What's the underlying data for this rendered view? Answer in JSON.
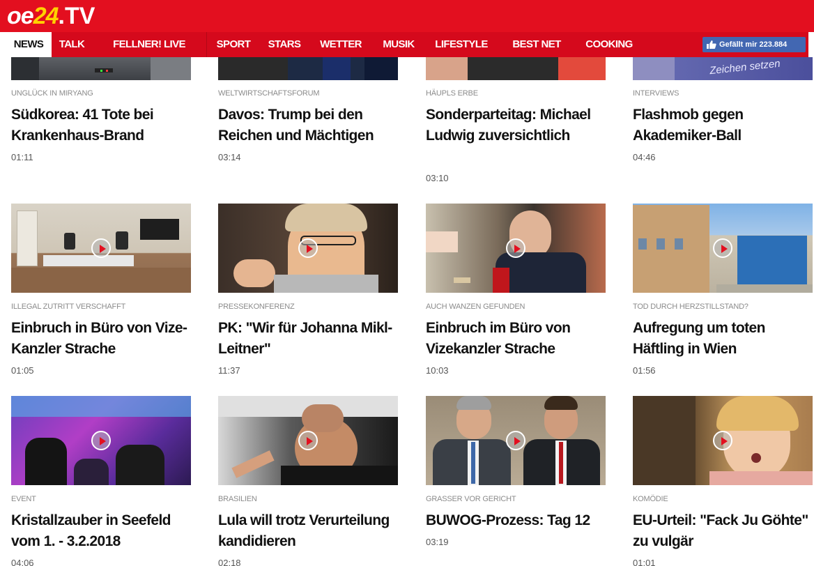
{
  "header": {
    "logo": {
      "part1": "oe",
      "part2": "24",
      "part3": ".TV"
    },
    "nav": [
      {
        "label": "NEWS",
        "active": true
      },
      {
        "label": "TALK"
      },
      {
        "label": "FELLNER! LIVE"
      },
      {
        "label": "SPORT"
      },
      {
        "label": "STARS"
      },
      {
        "label": "WETTER"
      },
      {
        "label": "MUSIK"
      },
      {
        "label": "LIFESTYLE"
      },
      {
        "label": "BEST NET"
      },
      {
        "label": "COOKING"
      }
    ],
    "like_button": {
      "icon": "thumbs-up-icon",
      "label": "Gefällt mir 223.884"
    }
  },
  "videos": [
    {
      "kicker": "UNGLÜCK IN MIRYANG",
      "title": "Südkorea: 41 Tote bei Krankenhaus-Brand",
      "duration": "01:11"
    },
    {
      "kicker": "WELTWIRTSCHAFTSFORUM",
      "title": "Davos: Trump bei den Reichen und Mächtigen",
      "duration": "03:14"
    },
    {
      "kicker": "HÄUPLS ERBE",
      "title": "Sonderparteitag: Michael Ludwig zuversichtlich",
      "duration": "03:10"
    },
    {
      "kicker": "INTERVIEWS",
      "title": "Flashmob gegen Akademiker-Ball",
      "duration": "04:46",
      "image_text": "Zeichen setzen"
    },
    {
      "kicker": "ILLEGAL ZUTRITT VERSCHAFFT",
      "title": "Einbruch in Büro von Vize-Kanzler Strache",
      "duration": "01:05"
    },
    {
      "kicker": "PRESSEKONFERENZ",
      "title": "PK: \"Wir für Johanna Mikl-Leitner\"",
      "duration": "11:37"
    },
    {
      "kicker": "AUCH WANZEN GEFUNDEN",
      "title": "Einbruch im Büro von Vizekanzler Strache",
      "duration": "10:03"
    },
    {
      "kicker": "TOD DURCH HERZSTILLSTAND?",
      "title": "Aufregung um toten Häftling in Wien",
      "duration": "01:56"
    },
    {
      "kicker": "EVENT",
      "title": "Kristallzauber in Seefeld vom 1. - 3.2.2018",
      "duration": "04:06"
    },
    {
      "kicker": "BRASILIEN",
      "title": "Lula will trotz Verurteilung kandidieren",
      "duration": "02:18"
    },
    {
      "kicker": "GRASSER VOR GERICHT",
      "title": "BUWOG-Prozess: Tag 12",
      "duration": "03:19"
    },
    {
      "kicker": "KOMÖDIE",
      "title": "EU-Urteil: \"Fack Ju Göhte\" zu vulgär",
      "duration": "01:01"
    }
  ],
  "colors": {
    "brand_red": "#e30f1f",
    "nav_red": "#d5091c",
    "logo_yellow": "#ffd200",
    "facebook_blue": "#4267b2",
    "play_red": "#e30f1f"
  }
}
